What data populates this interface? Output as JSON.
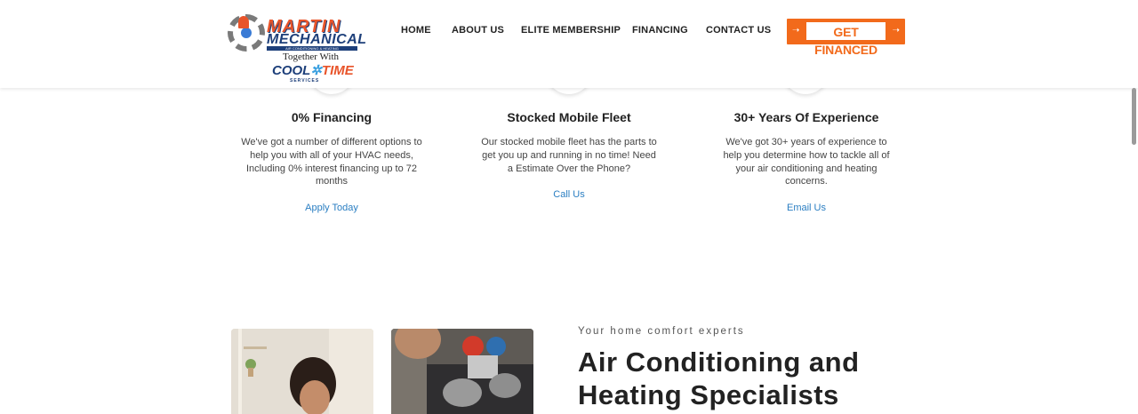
{
  "logo": {
    "line1": "MARTIN",
    "line2": "MECHANICAL",
    "strip": "AIR CONDITIONING & HEATING",
    "together": "Together With",
    "cool": "COOL",
    "time": "TIME",
    "services": "SERVICES"
  },
  "nav": {
    "items": [
      "HOME",
      "ABOUT US",
      "ELITE MEMBERSHIP",
      "FINANCING",
      "CONTACT US"
    ],
    "cta_label": "GET FINANCED"
  },
  "features": [
    {
      "title": "0% Financing",
      "description": "We've got a number of different options to help you with all of your HVAC needs, Including 0% interest financing up to 72 months",
      "link": "Apply Today"
    },
    {
      "title": "Stocked Mobile Fleet",
      "description": "Our stocked mobile fleet has the parts to get you up and running in no time! Need a Estimate Over the Phone?",
      "link": "Call Us"
    },
    {
      "title": "30+ Years Of Experience",
      "description": "We've got 30+ years of experience to help you determine how to tackle all of your air conditioning and heating concerns.",
      "link": "Email Us"
    }
  ],
  "about": {
    "tagline": "Your home comfort experts",
    "headline": "Air Conditioning and Heating Specialists"
  },
  "colors": {
    "accent": "#f26a1b",
    "link": "#2a7ec2",
    "brand_blue": "#1d3f7a",
    "brand_orange": "#e8542a"
  }
}
